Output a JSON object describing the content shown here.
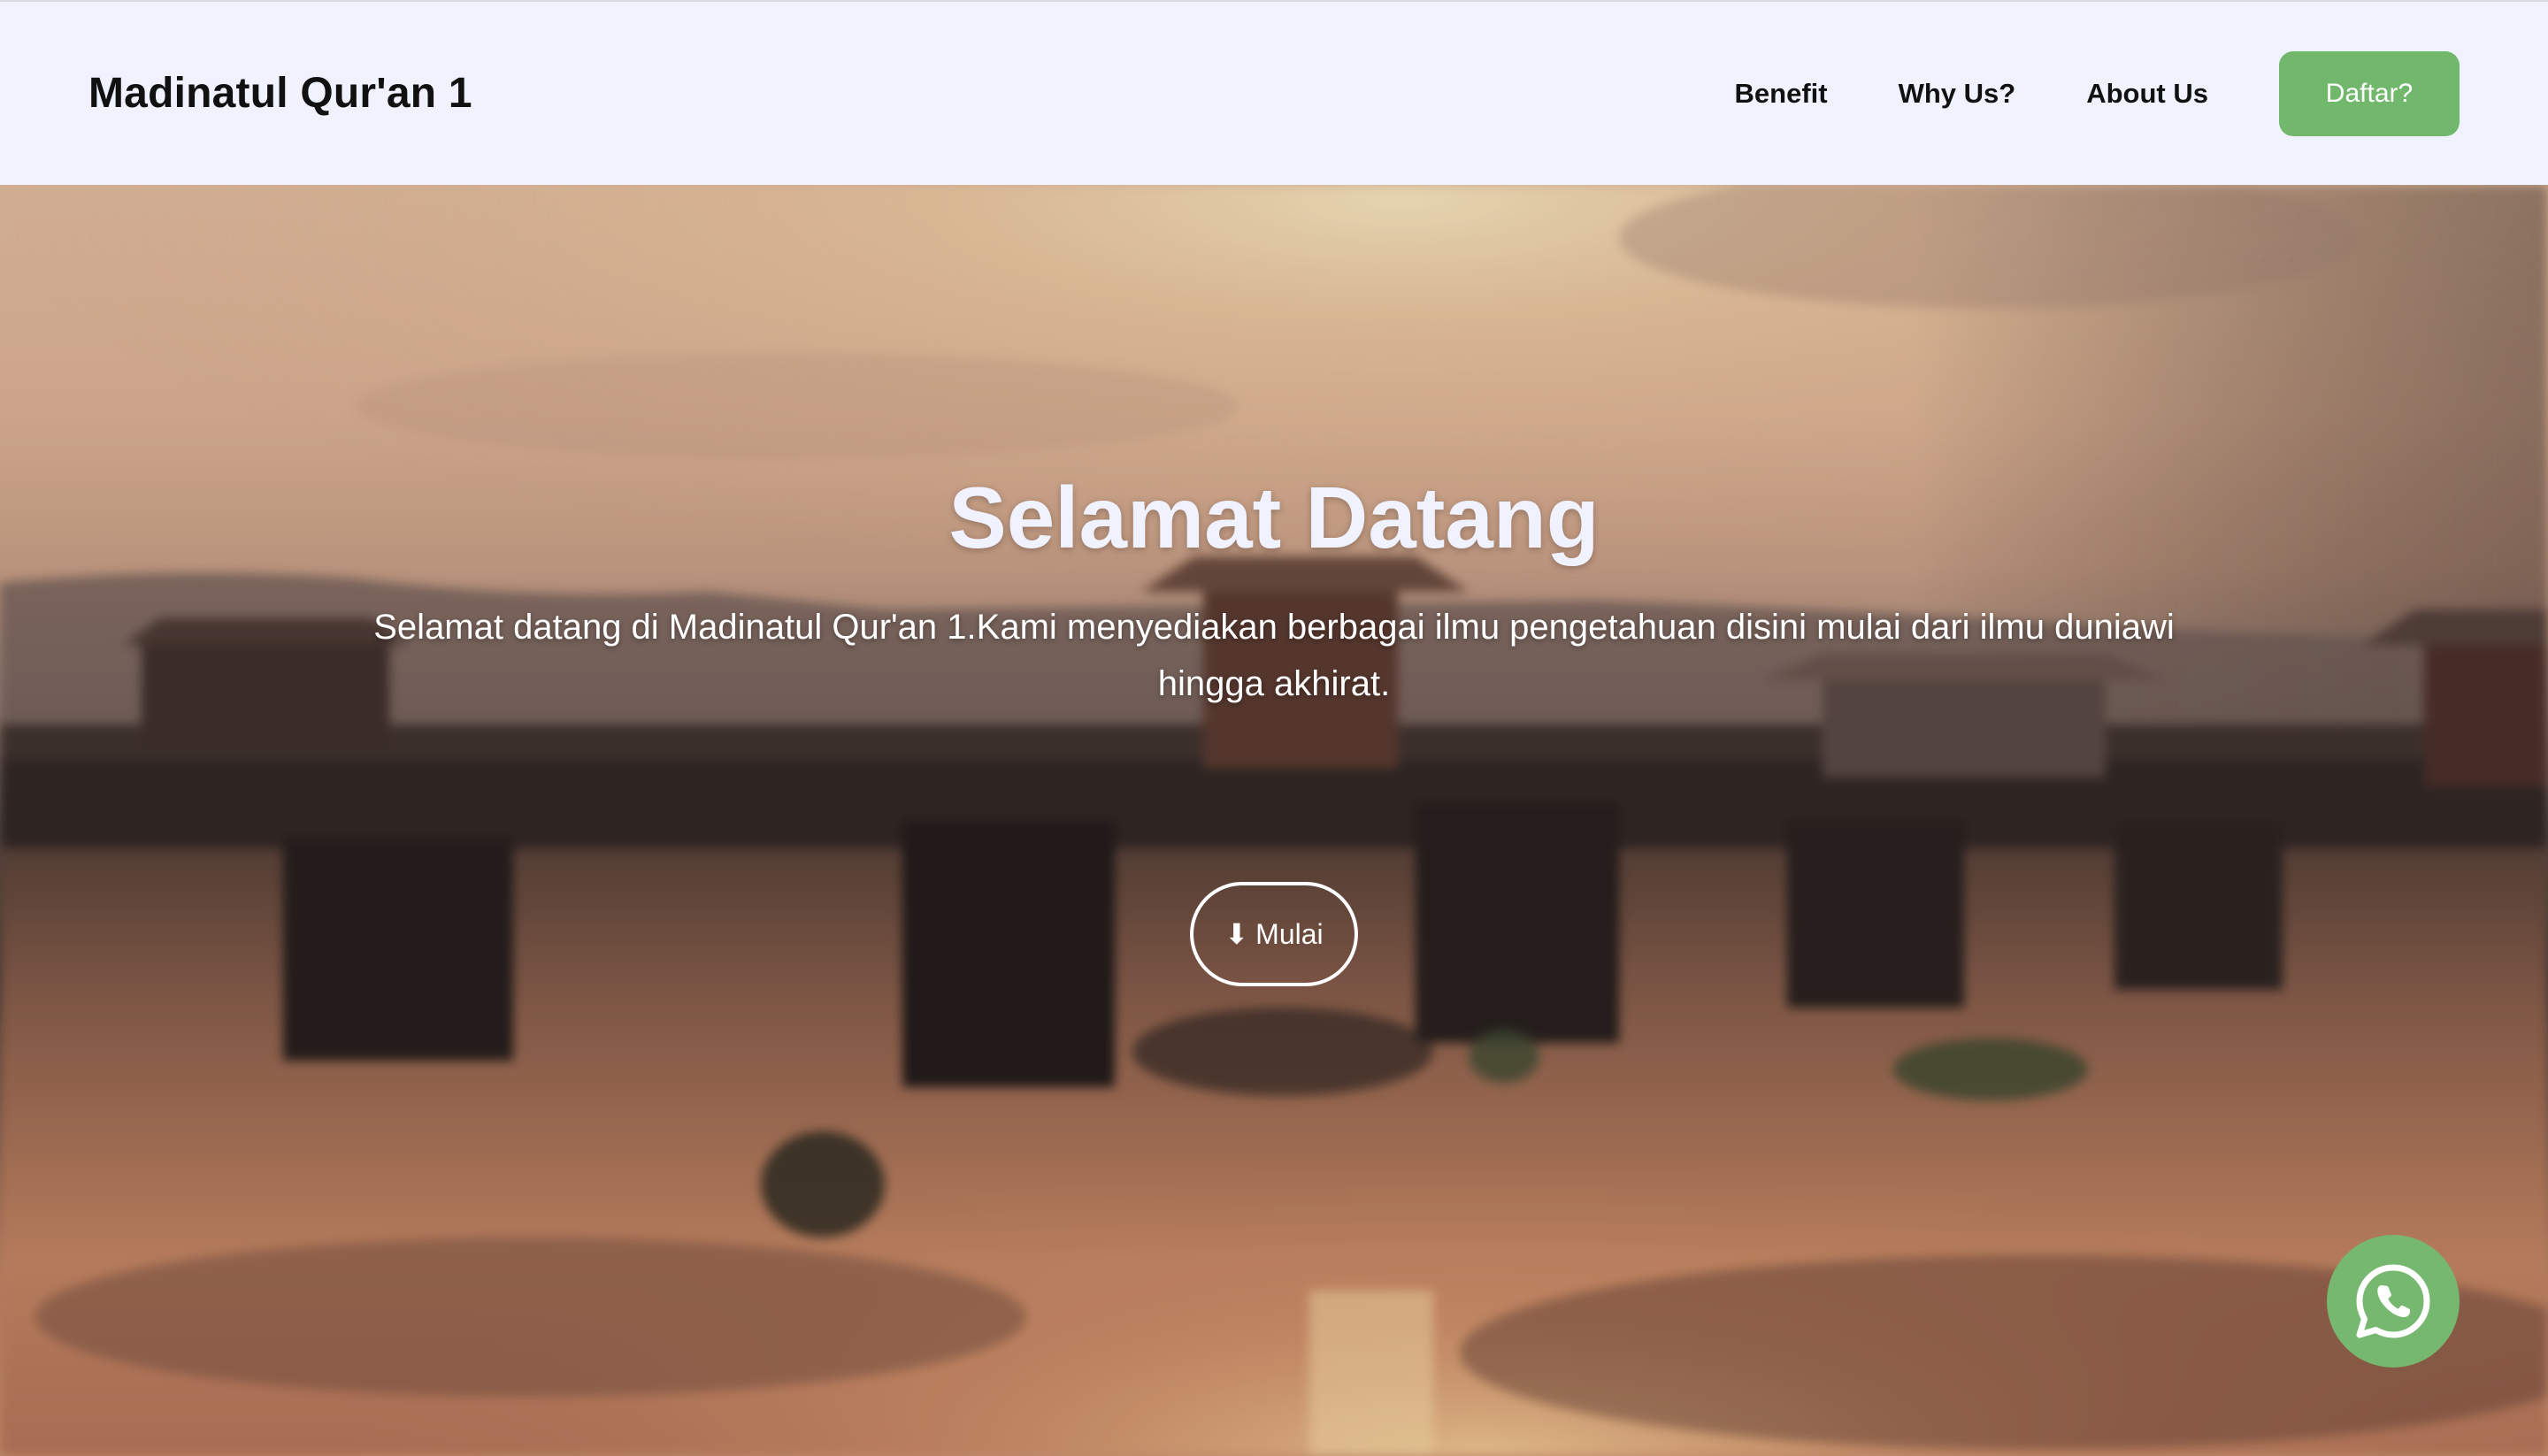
{
  "brand": {
    "name": "Madinatul Qur'an 1"
  },
  "nav": {
    "items": [
      {
        "label": "Benefit"
      },
      {
        "label": "Why Us?"
      },
      {
        "label": "About Us"
      }
    ],
    "cta_label": "Daftar?"
  },
  "hero": {
    "title": "Selamat Datang",
    "subtitle": "Selamat datang di Madinatul Qur'an 1.Kami menyediakan berbagai ilmu pengetahuan disini mulai dari ilmu duniawi hingga akhirat.",
    "start_button": {
      "icon": "arrow-down-icon",
      "label": "Mulai"
    }
  },
  "floating": {
    "whatsapp_icon": "whatsapp-icon"
  },
  "colors": {
    "navbar_bg": "#f0f3ff",
    "accent_green": "#72b86c",
    "hero_title": "#f1f2ff"
  }
}
